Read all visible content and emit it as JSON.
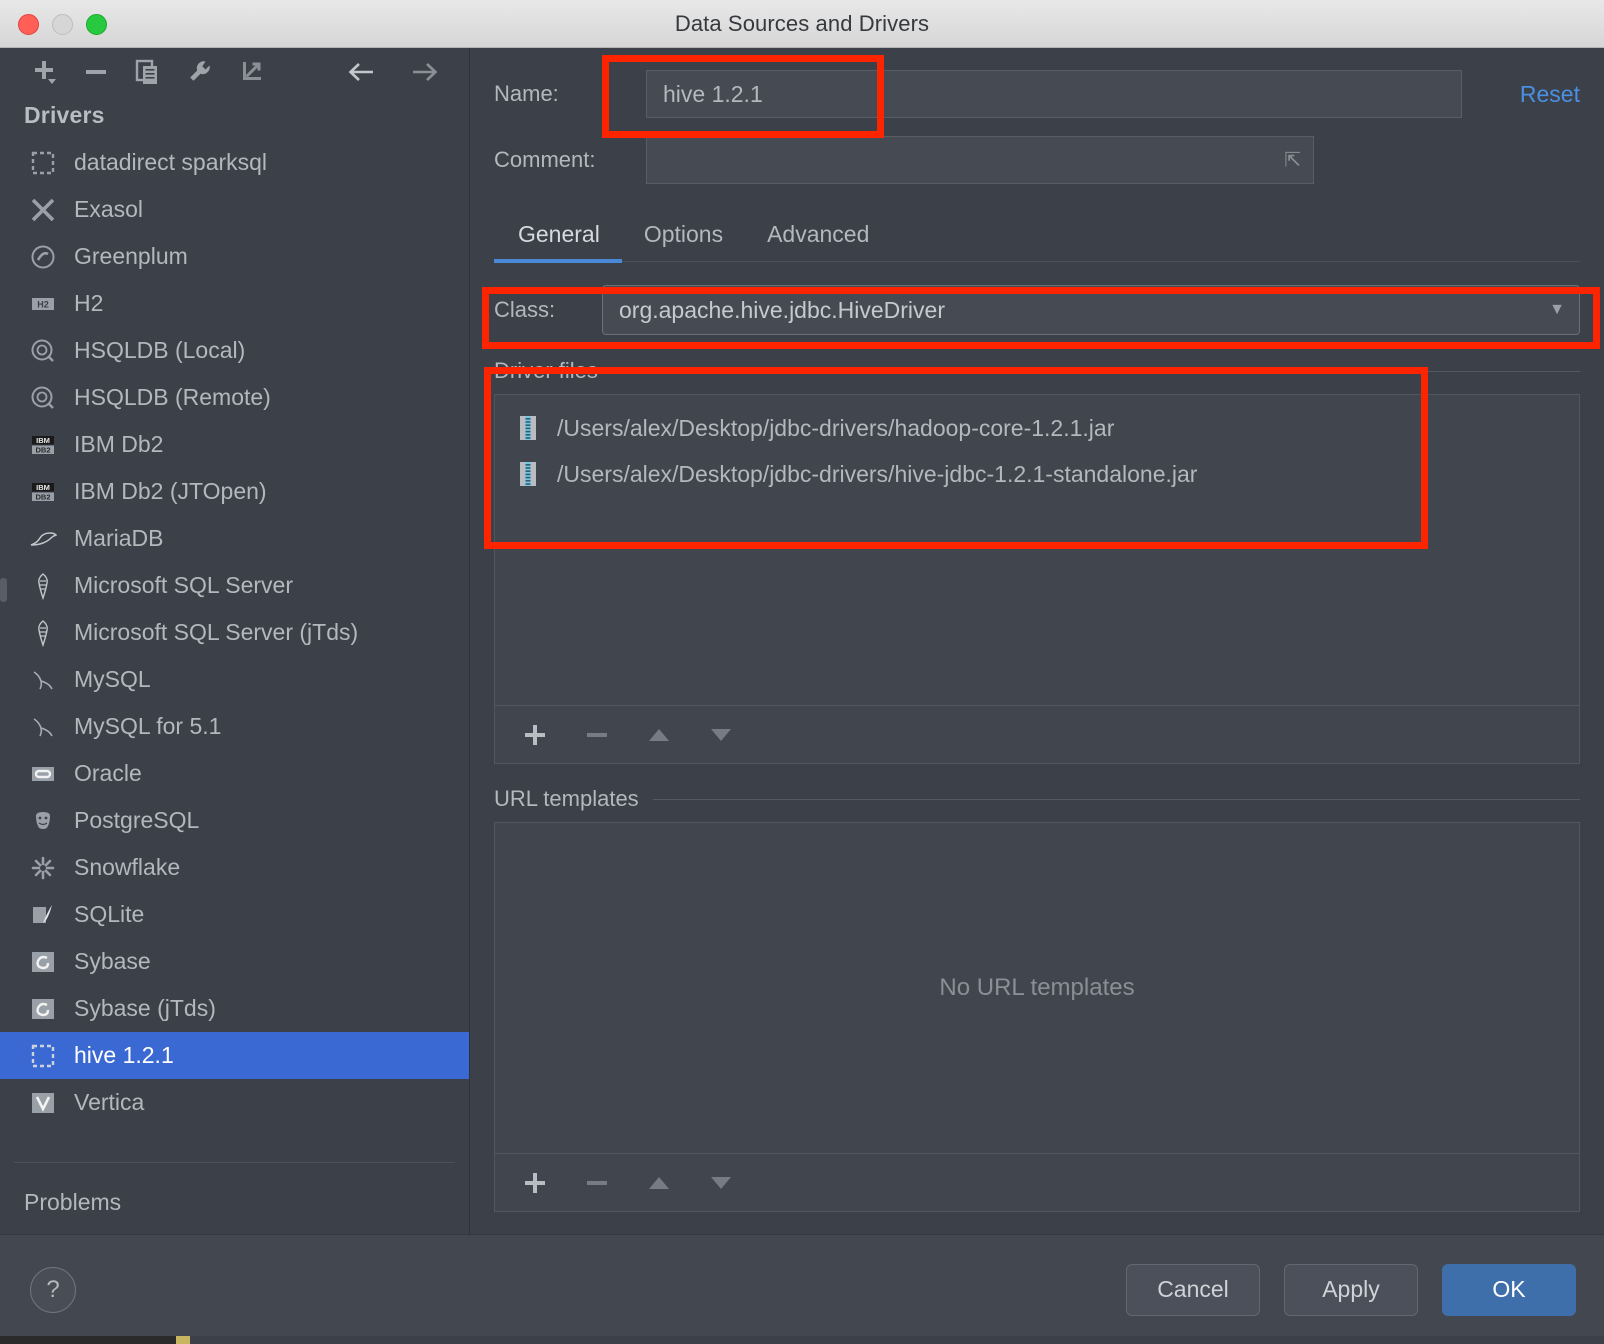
{
  "window": {
    "title": "Data Sources and Drivers",
    "traffic_lights": [
      "close",
      "minimize",
      "maximize"
    ]
  },
  "sidebar": {
    "toolbar": [
      {
        "name": "add-driver-button",
        "icon": "plus-dropdown-icon"
      },
      {
        "name": "remove-driver-button",
        "icon": "minus-icon"
      },
      {
        "name": "duplicate-driver-button",
        "icon": "copy-icon"
      },
      {
        "name": "driver-settings-button",
        "icon": "wrench-icon"
      },
      {
        "name": "import-driver-button",
        "icon": "import-arrow-icon"
      },
      {
        "name": "navigate-back-button",
        "icon": "arrow-left-icon"
      },
      {
        "name": "navigate-forward-button",
        "icon": "arrow-right-icon"
      }
    ],
    "heading": "Drivers",
    "items": [
      {
        "label": "datadirect sparksql",
        "icon": "dashed-square-icon",
        "selected": false
      },
      {
        "label": "Exasol",
        "icon": "exasol-x-icon",
        "selected": false
      },
      {
        "label": "Greenplum",
        "icon": "greenplum-circle-icon",
        "selected": false
      },
      {
        "label": "H2",
        "icon": "h2-badge-icon",
        "selected": false
      },
      {
        "label": "HSQLDB (Local)",
        "icon": "hsqldb-circle-icon",
        "selected": false
      },
      {
        "label": "HSQLDB (Remote)",
        "icon": "hsqldb-circle-icon",
        "selected": false
      },
      {
        "label": "IBM Db2",
        "icon": "ibm-db2-badge-icon",
        "selected": false
      },
      {
        "label": "IBM Db2 (JTOpen)",
        "icon": "ibm-db2-badge-icon",
        "selected": false
      },
      {
        "label": "MariaDB",
        "icon": "mariadb-seal-icon",
        "selected": false
      },
      {
        "label": "Microsoft SQL Server",
        "icon": "mssql-icon",
        "selected": false
      },
      {
        "label": "Microsoft SQL Server (jTds)",
        "icon": "mssql-icon",
        "selected": false
      },
      {
        "label": "MySQL",
        "icon": "mysql-dolphin-icon",
        "selected": false
      },
      {
        "label": "MySQL for 5.1",
        "icon": "mysql-dolphin-icon",
        "selected": false
      },
      {
        "label": "Oracle",
        "icon": "oracle-badge-icon",
        "selected": false
      },
      {
        "label": "PostgreSQL",
        "icon": "postgres-elephant-icon",
        "selected": false
      },
      {
        "label": "Snowflake",
        "icon": "snowflake-icon",
        "selected": false
      },
      {
        "label": "SQLite",
        "icon": "sqlite-feather-icon",
        "selected": false
      },
      {
        "label": "Sybase",
        "icon": "sybase-spiral-icon",
        "selected": false
      },
      {
        "label": "Sybase (jTds)",
        "icon": "sybase-spiral-icon",
        "selected": false
      },
      {
        "label": "hive 1.2.1",
        "icon": "dashed-square-icon",
        "selected": true
      },
      {
        "label": "Vertica",
        "icon": "vertica-badge-icon",
        "selected": false
      }
    ],
    "problems_label": "Problems"
  },
  "form": {
    "name_label": "Name:",
    "name_value": "hive 1.2.1",
    "name_placeholder": "",
    "comment_label": "Comment:",
    "comment_value": "",
    "comment_placeholder": "",
    "reset_label": "Reset"
  },
  "tabs": [
    {
      "label": "General",
      "active": true
    },
    {
      "label": "Options",
      "active": false
    },
    {
      "label": "Advanced",
      "active": false
    }
  ],
  "general": {
    "class_label": "Class:",
    "class_value": "org.apache.hive.jdbc.HiveDriver",
    "driver_files": {
      "title": "Driver files",
      "files": [
        "/Users/alex/Desktop/jdbc-drivers/hadoop-core-1.2.1.jar",
        "/Users/alex/Desktop/jdbc-drivers/hive-jdbc-1.2.1-standalone.jar"
      ],
      "toolbar": [
        "add",
        "remove",
        "move-up",
        "move-down"
      ]
    },
    "url_templates": {
      "title": "URL templates",
      "empty_message": "No URL templates",
      "rows": [],
      "toolbar": [
        "add",
        "remove",
        "move-up",
        "move-down"
      ]
    }
  },
  "footer": {
    "help_label": "?",
    "cancel_label": "Cancel",
    "apply_label": "Apply",
    "ok_label": "OK"
  },
  "annotations": [
    {
      "name": "name-field-highlight",
      "color": "#ff2400"
    },
    {
      "name": "class-row-highlight",
      "color": "#ff2400"
    },
    {
      "name": "driver-files-highlight",
      "color": "#ff2400"
    }
  ],
  "colors": {
    "accent_blue": "#3b69d4",
    "link_blue": "#4a90e2",
    "annotation_red": "#ff2400",
    "panel_bg": "#3c4049",
    "ok_button": "#3f6fab"
  }
}
